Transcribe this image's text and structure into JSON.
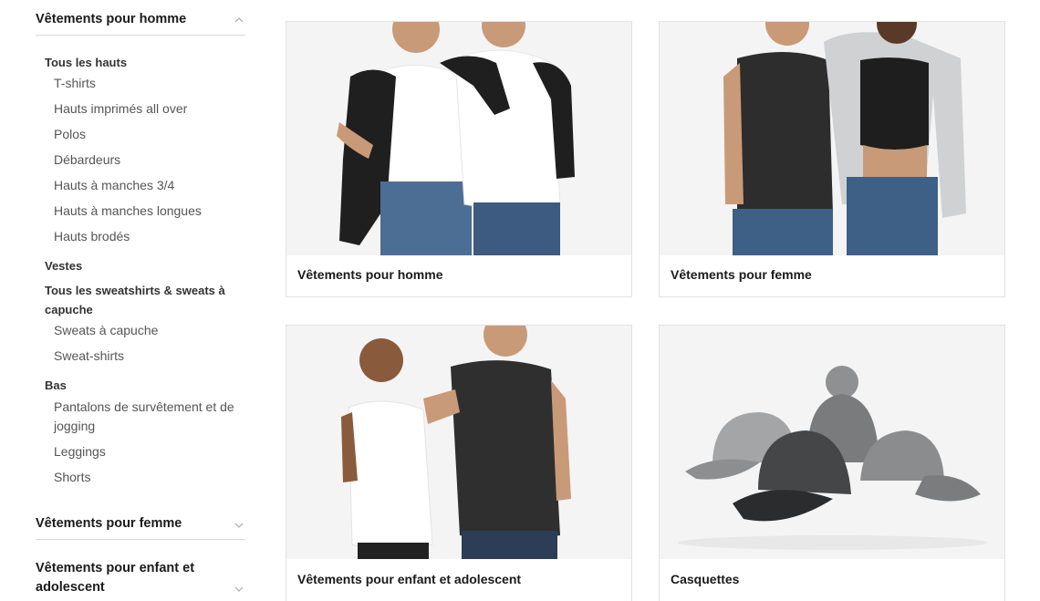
{
  "sidebar": {
    "sections": [
      {
        "title": "Vêtements pour homme",
        "expanded": true,
        "chevron": "chevron-up-icon",
        "groups": [
          {
            "label": "Tous les hauts",
            "items": [
              "T-shirts",
              "Hauts imprimés all over",
              "Polos",
              "Débardeurs",
              "Hauts à manches 3/4",
              "Hauts à manches longues",
              "Hauts brodés"
            ]
          },
          {
            "label": "Vestes",
            "items": []
          },
          {
            "label": "Tous les sweatshirts & sweats à capuche",
            "items": [
              "Sweats à capuche",
              "Sweat-shirts"
            ]
          },
          {
            "label": "Bas",
            "items": [
              "Pantalons de survêtement et de jogging",
              "Leggings",
              "Shorts"
            ]
          }
        ]
      },
      {
        "title": "Vêtements pour femme",
        "expanded": false,
        "chevron": "chevron-down-icon"
      },
      {
        "title": "Vêtements pour enfant et adolescent",
        "expanded": false,
        "chevron": "chevron-down-icon"
      }
    ]
  },
  "cards": [
    {
      "label": "Vêtements pour homme"
    },
    {
      "label": "Vêtements pour femme"
    },
    {
      "label": "Vêtements pour enfant et adolescent"
    },
    {
      "label": "Casquettes"
    }
  ],
  "colors": {
    "text_dark": "#1a1a1a",
    "text_sub": "#555555",
    "divider": "#d9d9d9",
    "card_border": "#e2e2e2",
    "image_bg": "#f2f2f2"
  }
}
